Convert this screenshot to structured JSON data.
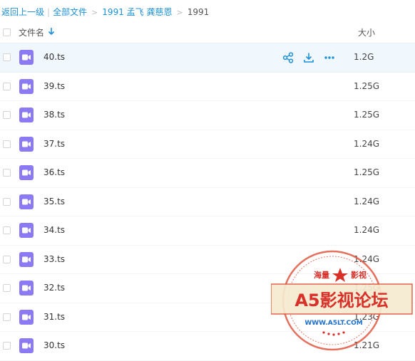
{
  "breadcrumb": {
    "back": "返回上一级",
    "all_files": "全部文件",
    "folder1": "1991 孟飞 龚慈恩",
    "current": "1991",
    "bar": "|",
    "arrow": ">"
  },
  "header": {
    "name_label": "文件名",
    "size_label": "大小"
  },
  "icons": {
    "file": "video-file-icon",
    "share": "share-icon",
    "download": "download-icon",
    "more": "more-icon",
    "sort": "sort-arrow-down-icon"
  },
  "colors": {
    "accent": "#1c90d8",
    "file_icon": "#8b7af3",
    "hover_row": "#f0f7fd"
  },
  "files": [
    {
      "name": "40.ts",
      "size": "1.2G"
    },
    {
      "name": "39.ts",
      "size": "1.25G"
    },
    {
      "name": "38.ts",
      "size": "1.25G"
    },
    {
      "name": "37.ts",
      "size": "1.24G"
    },
    {
      "name": "36.ts",
      "size": "1.25G"
    },
    {
      "name": "35.ts",
      "size": "1.24G"
    },
    {
      "name": "34.ts",
      "size": "1.24G"
    },
    {
      "name": "33.ts",
      "size": "1.24G"
    },
    {
      "name": "32.ts",
      "size": "1.25G"
    },
    {
      "name": "31.ts",
      "size": "1.23G"
    },
    {
      "name": "30.ts",
      "size": "1.21G"
    }
  ],
  "watermark": {
    "top_left": "海量",
    "top_right": "影视",
    "title": "A5影视论坛",
    "url": "WWW.A5LT.COM"
  }
}
